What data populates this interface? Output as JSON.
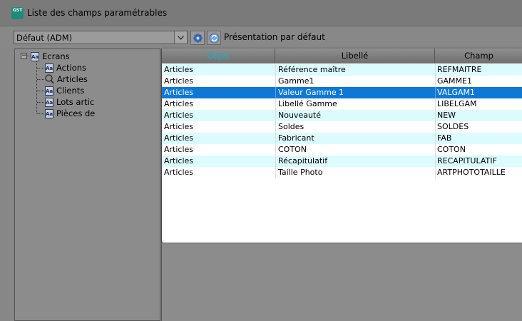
{
  "window": {
    "title": "Liste des champs paramétrables",
    "app_icon_text": "GST"
  },
  "toolbar": {
    "combo_value": "Défaut (ADM)",
    "presentation_label": "Présentation par défaut",
    "settings_icon": "gear-icon",
    "refresh_icon": "refresh-icon"
  },
  "tree": {
    "root": "Ecrans",
    "root_expander": "−",
    "icon_text": "Aa",
    "children": [
      "Actions",
      "Articles",
      "Clients",
      "Lots artic",
      "Pièces de"
    ]
  },
  "grid": {
    "columns": [
      "Objet",
      "Libellé",
      "Champ"
    ],
    "sorted_column_color": "#19b3c7",
    "selection_color": "#0f78d7",
    "alt_row_color": "#dcfbfd",
    "rows": [
      {
        "objet": "Articles",
        "libelle": "Référence maître",
        "champ": "REFMAITRE"
      },
      {
        "objet": "Articles",
        "libelle": "Gamme1",
        "champ": "GAMME1"
      },
      {
        "objet": "Articles",
        "libelle": "Valeur Gamme 1",
        "champ": "VALGAM1"
      },
      {
        "objet": "Articles",
        "libelle": "Libellé Gamme",
        "champ": "LIBELGAM"
      },
      {
        "objet": "Articles",
        "libelle": "Nouveauté",
        "champ": "NEW"
      },
      {
        "objet": "Articles",
        "libelle": "Soldes",
        "champ": "SOLDES"
      },
      {
        "objet": "Articles",
        "libelle": "Fabricant",
        "champ": "FAB"
      },
      {
        "objet": "Articles",
        "libelle": "COTON",
        "champ": "COTON"
      },
      {
        "objet": "Articles",
        "libelle": "Récapitulatif",
        "champ": "RECAPITULATIF"
      },
      {
        "objet": "Articles",
        "libelle": "Taille Photo",
        "champ": "ARTPHOTOTAILLE"
      }
    ]
  }
}
